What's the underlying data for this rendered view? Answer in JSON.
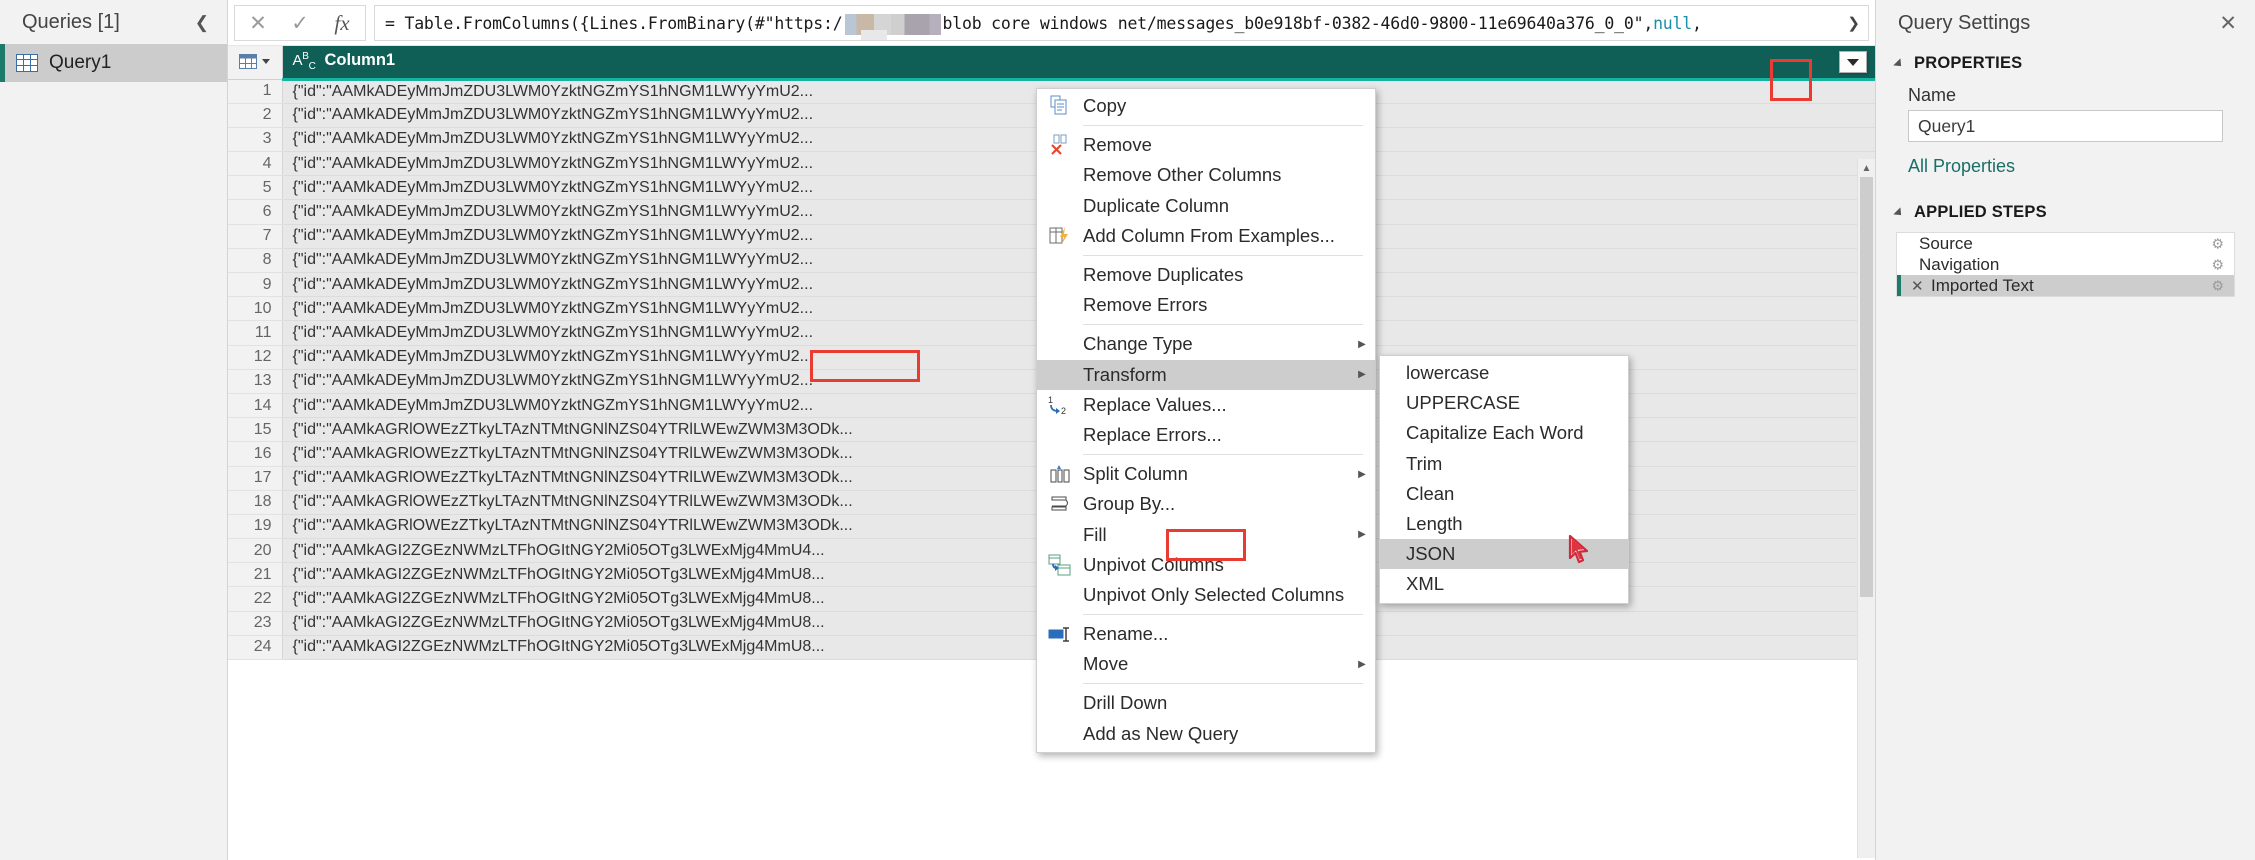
{
  "queries_pane": {
    "title": "Queries [1]",
    "collapse_icon": "chevron-left-icon",
    "items": [
      {
        "label": "Query1",
        "icon": "table-icon",
        "selected": true
      }
    ]
  },
  "formula_bar": {
    "cancel_label": "✕",
    "accept_label": "✓",
    "fx_label": "fx",
    "expand_icon": "chevron-down-icon",
    "formula_part1": "= Table.FromColumns({Lines.FromBinary(#\"https:/",
    "redacted": "[redacted]",
    "formula_part2": " blob core windows net/messages_b0e918bf-0382-46d0-9800-11e69640a376_0_0\"",
    "formula_part3": ",",
    "formula_null": "null",
    "formula_part4": ","
  },
  "grid": {
    "type_icon": "abc-text-type-icon",
    "type_label_a": "A",
    "type_label_b": "B",
    "type_label_c": "C",
    "column_header": "Column1",
    "filter_button_icon": "filter-dropdown-icon",
    "rows": [
      {
        "n": "1",
        "value": "{\"id\":\"AAMkADEyMmJmZDU3LWM0YzktNGZmYS1hNGM1LWYyYmU2..."
      },
      {
        "n": "2",
        "value": "{\"id\":\"AAMkADEyMmJmZDU3LWM0YzktNGZmYS1hNGM1LWYyYmU2..."
      },
      {
        "n": "3",
        "value": "{\"id\":\"AAMkADEyMmJmZDU3LWM0YzktNGZmYS1hNGM1LWYyYmU2..."
      },
      {
        "n": "4",
        "value": "{\"id\":\"AAMkADEyMmJmZDU3LWM0YzktNGZmYS1hNGM1LWYyYmU2..."
      },
      {
        "n": "5",
        "value": "{\"id\":\"AAMkADEyMmJmZDU3LWM0YzktNGZmYS1hNGM1LWYyYmU2..."
      },
      {
        "n": "6",
        "value": "{\"id\":\"AAMkADEyMmJmZDU3LWM0YzktNGZmYS1hNGM1LWYyYmU2..."
      },
      {
        "n": "7",
        "value": "{\"id\":\"AAMkADEyMmJmZDU3LWM0YzktNGZmYS1hNGM1LWYyYmU2..."
      },
      {
        "n": "8",
        "value": "{\"id\":\"AAMkADEyMmJmZDU3LWM0YzktNGZmYS1hNGM1LWYyYmU2..."
      },
      {
        "n": "9",
        "value": "{\"id\":\"AAMkADEyMmJmZDU3LWM0YzktNGZmYS1hNGM1LWYyYmU2..."
      },
      {
        "n": "10",
        "value": "{\"id\":\"AAMkADEyMmJmZDU3LWM0YzktNGZmYS1hNGM1LWYyYmU2..."
      },
      {
        "n": "11",
        "value": "{\"id\":\"AAMkADEyMmJmZDU3LWM0YzktNGZmYS1hNGM1LWYyYmU2..."
      },
      {
        "n": "12",
        "value": "{\"id\":\"AAMkADEyMmJmZDU3LWM0YzktNGZmYS1hNGM1LWYyYmU2..."
      },
      {
        "n": "13",
        "value": "{\"id\":\"AAMkADEyMmJmZDU3LWM0YzktNGZmYS1hNGM1LWYyYmU2..."
      },
      {
        "n": "14",
        "value": "{\"id\":\"AAMkADEyMmJmZDU3LWM0YzktNGZmYS1hNGM1LWYyYmU2..."
      },
      {
        "n": "15",
        "value": "{\"id\":\"AAMkAGRlOWEzZTkyLTAzNTMtNGNlNZS04YTRlLWEwZWM3M3ODk..."
      },
      {
        "n": "16",
        "value": "{\"id\":\"AAMkAGRlOWEzZTkyLTAzNTMtNGNlNZS04YTRlLWEwZWM3M3ODk..."
      },
      {
        "n": "17",
        "value": "{\"id\":\"AAMkAGRlOWEzZTkyLTAzNTMtNGNlNZS04YTRlLWEwZWM3M3ODk..."
      },
      {
        "n": "18",
        "value": "{\"id\":\"AAMkAGRlOWEzZTkyLTAzNTMtNGNlNZS04YTRlLWEwZWM3M3ODk..."
      },
      {
        "n": "19",
        "value": "{\"id\":\"AAMkAGRlOWEzZTkyLTAzNTMtNGNlNZS04YTRlLWEwZWM3M3ODk..."
      },
      {
        "n": "20",
        "value": "{\"id\":\"AAMkAGI2ZGEzNWMzLTFhOGItNGY2Mi05OTg3LWExMjg4MmU4..."
      },
      {
        "n": "21",
        "value": "{\"id\":\"AAMkAGI2ZGEzNWMzLTFhOGItNGY2Mi05OTg3LWExMjg4MmU8..."
      },
      {
        "n": "22",
        "value": "{\"id\":\"AAMkAGI2ZGEzNWMzLTFhOGItNGY2Mi05OTg3LWExMjg4MmU8..."
      },
      {
        "n": "23",
        "value": "{\"id\":\"AAMkAGI2ZGEzNWMzLTFhOGItNGY2Mi05OTg3LWExMjg4MmU8..."
      },
      {
        "n": "24",
        "value": "{\"id\":\"AAMkAGI2ZGEzNWMzLTFhOGItNGY2Mi05OTg3LWExMjg4MmU8..."
      }
    ]
  },
  "context_menu": {
    "items": [
      {
        "label": "Copy",
        "icon": "copy-icon",
        "arrow": "",
        "highlight": false,
        "sep_after": true
      },
      {
        "label": "Remove",
        "icon": "remove-column-icon",
        "arrow": "",
        "highlight": false,
        "sep_after": false
      },
      {
        "label": "Remove Other Columns",
        "icon": "",
        "arrow": "",
        "highlight": false,
        "sep_after": false
      },
      {
        "label": "Duplicate Column",
        "icon": "",
        "arrow": "",
        "highlight": false,
        "sep_after": false
      },
      {
        "label": "Add Column From Examples...",
        "icon": "add-column-examples-icon",
        "arrow": "",
        "highlight": false,
        "sep_after": true
      },
      {
        "label": "Remove Duplicates",
        "icon": "",
        "arrow": "",
        "highlight": false,
        "sep_after": false
      },
      {
        "label": "Remove Errors",
        "icon": "",
        "arrow": "",
        "highlight": false,
        "sep_after": true
      },
      {
        "label": "Change Type",
        "icon": "",
        "arrow": "▶",
        "highlight": false,
        "sep_after": false
      },
      {
        "label": "Transform",
        "icon": "",
        "arrow": "▶",
        "highlight": true,
        "sep_after": false
      },
      {
        "label": "Replace Values...",
        "icon": "replace-values-icon",
        "arrow": "",
        "highlight": false,
        "sep_after": false
      },
      {
        "label": "Replace Errors...",
        "icon": "",
        "arrow": "",
        "highlight": false,
        "sep_after": true
      },
      {
        "label": "Split Column",
        "icon": "split-column-icon",
        "arrow": "▶",
        "highlight": false,
        "sep_after": false
      },
      {
        "label": "Group By...",
        "icon": "group-by-icon",
        "arrow": "",
        "highlight": false,
        "sep_after": false
      },
      {
        "label": "Fill",
        "icon": "",
        "arrow": "▶",
        "highlight": false,
        "sep_after": false
      },
      {
        "label": "Unpivot Columns",
        "icon": "unpivot-columns-icon",
        "arrow": "",
        "highlight": false,
        "sep_after": false
      },
      {
        "label": "Unpivot Only Selected Columns",
        "icon": "",
        "arrow": "",
        "highlight": false,
        "sep_after": true
      },
      {
        "label": "Rename...",
        "icon": "rename-icon",
        "arrow": "",
        "highlight": false,
        "sep_after": false
      },
      {
        "label": "Move",
        "icon": "",
        "arrow": "▶",
        "highlight": false,
        "sep_after": true
      },
      {
        "label": "Drill Down",
        "icon": "",
        "arrow": "",
        "highlight": false,
        "sep_after": false
      },
      {
        "label": "Add as New Query",
        "icon": "",
        "arrow": "",
        "highlight": false,
        "sep_after": false
      }
    ]
  },
  "transform_submenu": {
    "items": [
      {
        "label": "lowercase",
        "highlight": false
      },
      {
        "label": "UPPERCASE",
        "highlight": false
      },
      {
        "label": "Capitalize Each Word",
        "highlight": false
      },
      {
        "label": "Trim",
        "highlight": false
      },
      {
        "label": "Clean",
        "highlight": false
      },
      {
        "label": "Length",
        "highlight": false
      },
      {
        "label": "JSON",
        "highlight": true
      },
      {
        "label": "XML",
        "highlight": false
      }
    ]
  },
  "query_settings": {
    "title": "Query Settings",
    "close_icon": "close-icon",
    "properties_section": "PROPERTIES",
    "name_label": "Name",
    "name_value": "Query1",
    "all_properties_link": "All Properties",
    "applied_steps_section": "APPLIED STEPS",
    "steps": [
      {
        "label": "Source",
        "selected": false,
        "has_delete": false,
        "gear": "gear-icon"
      },
      {
        "label": "Navigation",
        "selected": false,
        "has_delete": false,
        "gear": "gear-icon"
      },
      {
        "label": "Imported Text",
        "selected": true,
        "has_delete": true,
        "delete_icon": "✕",
        "gear": "gear-icon"
      }
    ]
  },
  "annotations": {
    "accent_red": "#ea3b33",
    "header_teal": "#0f5f57",
    "accent_teal": "#15b3a0",
    "link_teal": "#1a6e68"
  }
}
